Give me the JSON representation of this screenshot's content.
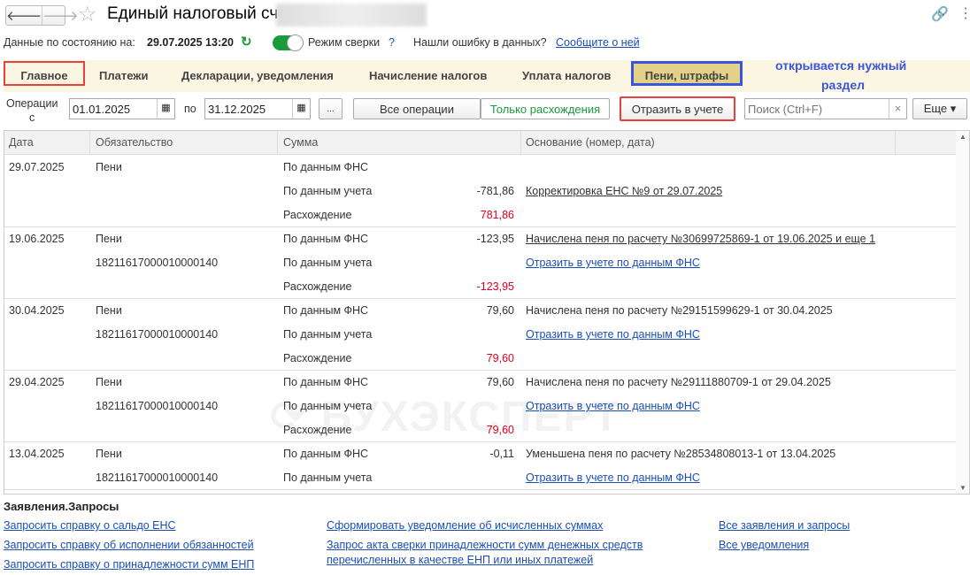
{
  "window": {
    "title": "Единый налоговый счет"
  },
  "status": {
    "label": "Данные по состоянию на:",
    "datetime": "29.07.2025 13:20",
    "mode_label": "Режим сверки",
    "help": "?",
    "error_question": "Нашли ошибку в данных?",
    "report_link": "Сообщите о ней"
  },
  "tabs": [
    {
      "label": "Главное"
    },
    {
      "label": "Платежи"
    },
    {
      "label": "Декларации, уведомления"
    },
    {
      "label": "Начисление налогов"
    },
    {
      "label": "Уплата налогов"
    },
    {
      "label": "Пени, штрафы"
    }
  ],
  "annotation": {
    "line1": "открывается нужный",
    "line2": "раздел"
  },
  "filter": {
    "label1": "Операции",
    "label2": "с",
    "from": "01.01.2025",
    "to_label": "по",
    "to": "31.12.2025",
    "more": "...",
    "all_ops": "Все операции",
    "only_diff": "Только расхождения",
    "reflect": "Отразить в учете",
    "search_placeholder": "Поиск (Ctrl+F)",
    "clear": "×",
    "more_btn": "Еще ▾"
  },
  "table": {
    "columns": [
      "Дата",
      "Обязательство",
      "Сумма",
      "Основание (номер, дата)"
    ],
    "rows": [
      {
        "date": "29.07.2025",
        "obligation": "Пени",
        "code": "",
        "lines": [
          {
            "label": "По данным ФНС",
            "amount": "",
            "basis": "",
            "link": false
          },
          {
            "label": "По данным учета",
            "amount": "-781,86",
            "basis": "Корректировка ЕНС №9 от 29.07.2025",
            "link": "dark"
          },
          {
            "label": "Расхождение",
            "amount": "781,86",
            "red": true,
            "basis": ""
          }
        ]
      },
      {
        "date": "19.06.2025",
        "obligation": "Пени",
        "code": "18211617000010000140",
        "lines": [
          {
            "label": "По данным ФНС",
            "amount": "-123,95",
            "basis": "Начислена пеня по расчету №30699725869-1 от 19.06.2025 и еще 1",
            "link": "dark"
          },
          {
            "label": "По данным учета",
            "amount": "",
            "basis": "Отразить в учете по данным ФНС",
            "link": "blue"
          },
          {
            "label": "Расхождение",
            "amount": "-123,95",
            "red": true,
            "basis": ""
          }
        ]
      },
      {
        "date": "30.04.2025",
        "obligation": "Пени",
        "code": "18211617000010000140",
        "lines": [
          {
            "label": "По данным ФНС",
            "amount": "79,60",
            "basis": "Начислена пеня по расчету №29151599629-1 от 30.04.2025"
          },
          {
            "label": "По данным учета",
            "amount": "",
            "basis": "Отразить в учете по данным ФНС",
            "link": "blue"
          },
          {
            "label": "Расхождение",
            "amount": "79,60",
            "red": true,
            "basis": ""
          }
        ]
      },
      {
        "date": "29.04.2025",
        "obligation": "Пени",
        "code": "18211617000010000140",
        "lines": [
          {
            "label": "По данным ФНС",
            "amount": "79,60",
            "basis": "Начислена пеня по расчету №29111880709-1 от 29.04.2025"
          },
          {
            "label": "По данным учета",
            "amount": "",
            "basis": "Отразить в учете по данным ФНС",
            "link": "blue"
          },
          {
            "label": "Расхождение",
            "amount": "79,60",
            "red": true,
            "basis": ""
          }
        ]
      },
      {
        "date": "13.04.2025",
        "obligation": "Пени",
        "code": "18211617000010000140",
        "lines": [
          {
            "label": "По данным ФНС",
            "amount": "-0,11",
            "basis": "Уменьшена пеня по расчету №28534808013-1 от 13.04.2025"
          },
          {
            "label": "По данным учета",
            "amount": "",
            "basis": "Отразить в учете по данным ФНС",
            "link": "blue"
          }
        ]
      }
    ]
  },
  "watermark": "БУХЭКСПЕРТ",
  "requests": {
    "title": "Заявления.Запросы",
    "col1": [
      "Запросить справку о сальдо ЕНС",
      "Запросить справку об исполнении обязанностей",
      "Запросить справку о принадлежности сумм ЕНП"
    ],
    "col2": [
      "Сформировать уведомление об исчисленных суммах",
      "Запрос акта сверки принадлежности сумм денежных средств",
      "перечисленных в качестве ЕНП или иных платежей"
    ],
    "col3": [
      "Все заявления и запросы",
      "Все уведомления"
    ]
  },
  "colors": {
    "accent_green": "#1a9a3c",
    "link": "#1a4fb5",
    "red": "#e0001b",
    "annotation": "#3a55e0"
  }
}
